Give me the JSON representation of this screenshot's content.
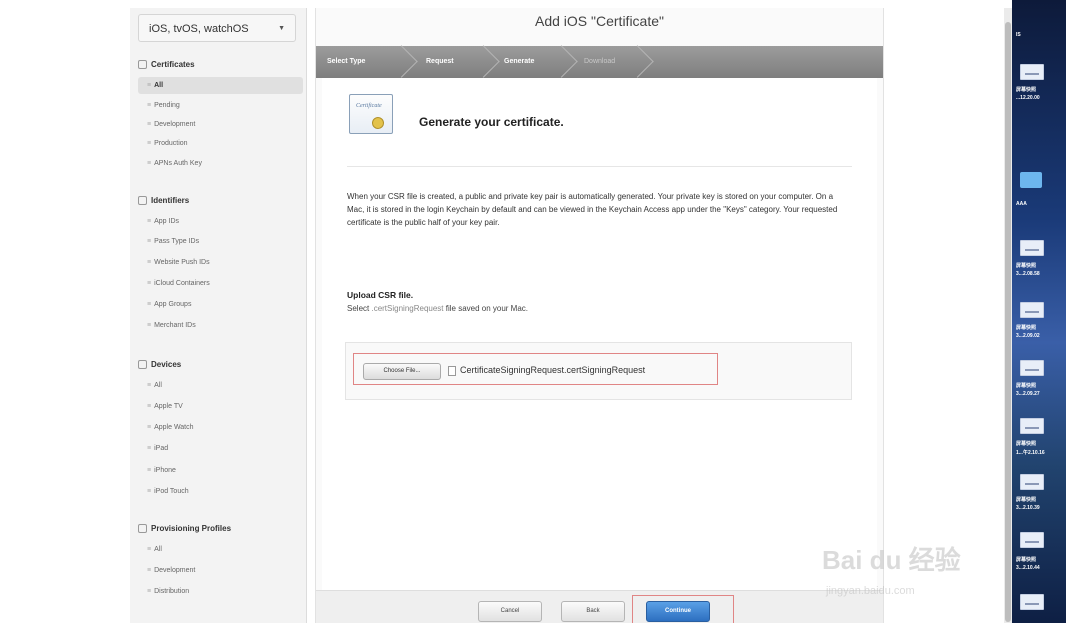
{
  "sidebar": {
    "platform": "iOS, tvOS, watchOS",
    "certificates": {
      "title": "Certificates",
      "items": [
        "All",
        "Pending",
        "Development",
        "Production",
        "APNs Auth Key"
      ]
    },
    "identifiers": {
      "title": "Identifiers",
      "items": [
        "App IDs",
        "Pass Type IDs",
        "Website Push IDs",
        "iCloud Containers",
        "App Groups",
        "Merchant IDs"
      ]
    },
    "devices": {
      "title": "Devices",
      "items": [
        "All",
        "Apple TV",
        "Apple Watch",
        "iPad",
        "iPhone",
        "iPod Touch"
      ]
    },
    "profiles": {
      "title": "Provisioning Profiles",
      "items": [
        "All",
        "Development",
        "Distribution"
      ]
    }
  },
  "main": {
    "title": "Add iOS \"Certificate\"",
    "steps": [
      "Select Type",
      "Request",
      "Generate",
      "Download"
    ],
    "heading": "Generate your certificate.",
    "icon_text": "Certificate",
    "paragraph": "When your CSR file is created, a public and private key pair is automatically generated. Your private key is stored on your computer. On a Mac, it is stored in the login Keychain by default and can be viewed in the Keychain Access app under the \"Keys\" category. Your requested certificate is the public half of your key pair.",
    "upload_heading": "Upload CSR file.",
    "upload_sub_pre": "Select ",
    "upload_sub_ext": ".certSigningRequest",
    "upload_sub_post": " file saved on your Mac.",
    "choose_file": "Choose File...",
    "file_name": "CertificateSigningRequest.certSigningRequest",
    "buttons": {
      "cancel": "Cancel",
      "back": "Back",
      "continue": "Continue"
    }
  },
  "desktop": {
    "labels": [
      "IS",
      "屏幕快照",
      "...12.20.00",
      "AAA",
      "屏幕快照",
      "3...2.08.58",
      "屏幕快照",
      "3...2.09.02",
      "屏幕快照",
      "3...2.09.27",
      "屏幕快照",
      "1...午2.10.16",
      "屏幕快照",
      "3...2.10.39",
      "屏幕快照",
      "3...2.10.44"
    ]
  },
  "watermark": {
    "logo": "Bai du 经验",
    "url": "jingyan.baidu.com"
  },
  "colors": {
    "highlight": "#e08585",
    "primary": "#2d6fc0"
  }
}
